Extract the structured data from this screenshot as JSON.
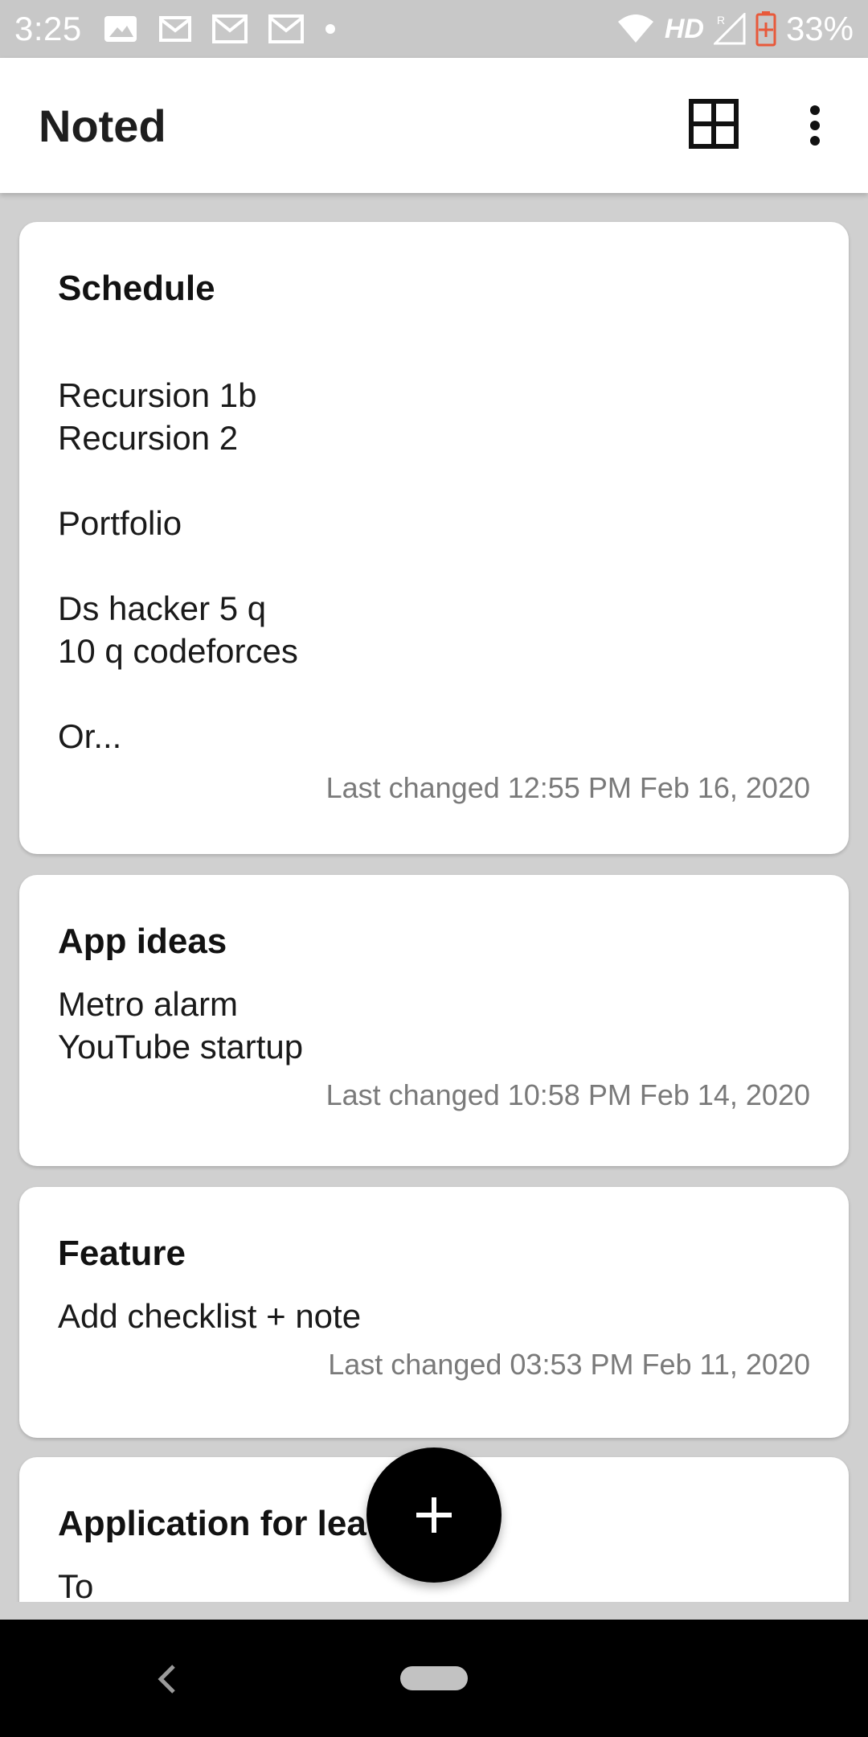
{
  "status_bar": {
    "time": "3:25",
    "network": "HD",
    "battery": "33%",
    "icons": [
      "image-notification-icon",
      "gmail-icon",
      "gmail-icon",
      "gmail-icon",
      "dot-icon",
      "wifi-icon",
      "signal-icon",
      "battery-icon"
    ]
  },
  "app_bar": {
    "title": "Noted",
    "grid_icon": "grid-view-icon",
    "more_icon": "more-vert-icon"
  },
  "notes": [
    {
      "title": "Schedule",
      "body": "\nRecursion 1b\nRecursion 2\n\nPortfolio\n\nDs hacker 5 q\n10 q codeforces\n\nOr...",
      "meta": "Last changed 12:55 PM Feb 16, 2020"
    },
    {
      "title": "App ideas",
      "body": "Metro alarm\nYouTube startup",
      "meta": "Last changed 10:58 PM Feb 14, 2020"
    },
    {
      "title": "Feature",
      "body": "Add checklist + note",
      "meta": "Last changed 03:53 PM Feb 11, 2020"
    },
    {
      "title": "Application for lea",
      "body": "To",
      "meta": ""
    }
  ],
  "fab": {
    "icon": "plus-icon"
  },
  "nav_bar": {
    "back_icon": "back-icon",
    "home_icon": "home-pill-icon"
  },
  "colors": {
    "background": "#d0d0d0",
    "card": "#ffffff",
    "fab": "#000000",
    "meta_text": "#7a7a7a",
    "battery_accent": "#e8593a"
  }
}
